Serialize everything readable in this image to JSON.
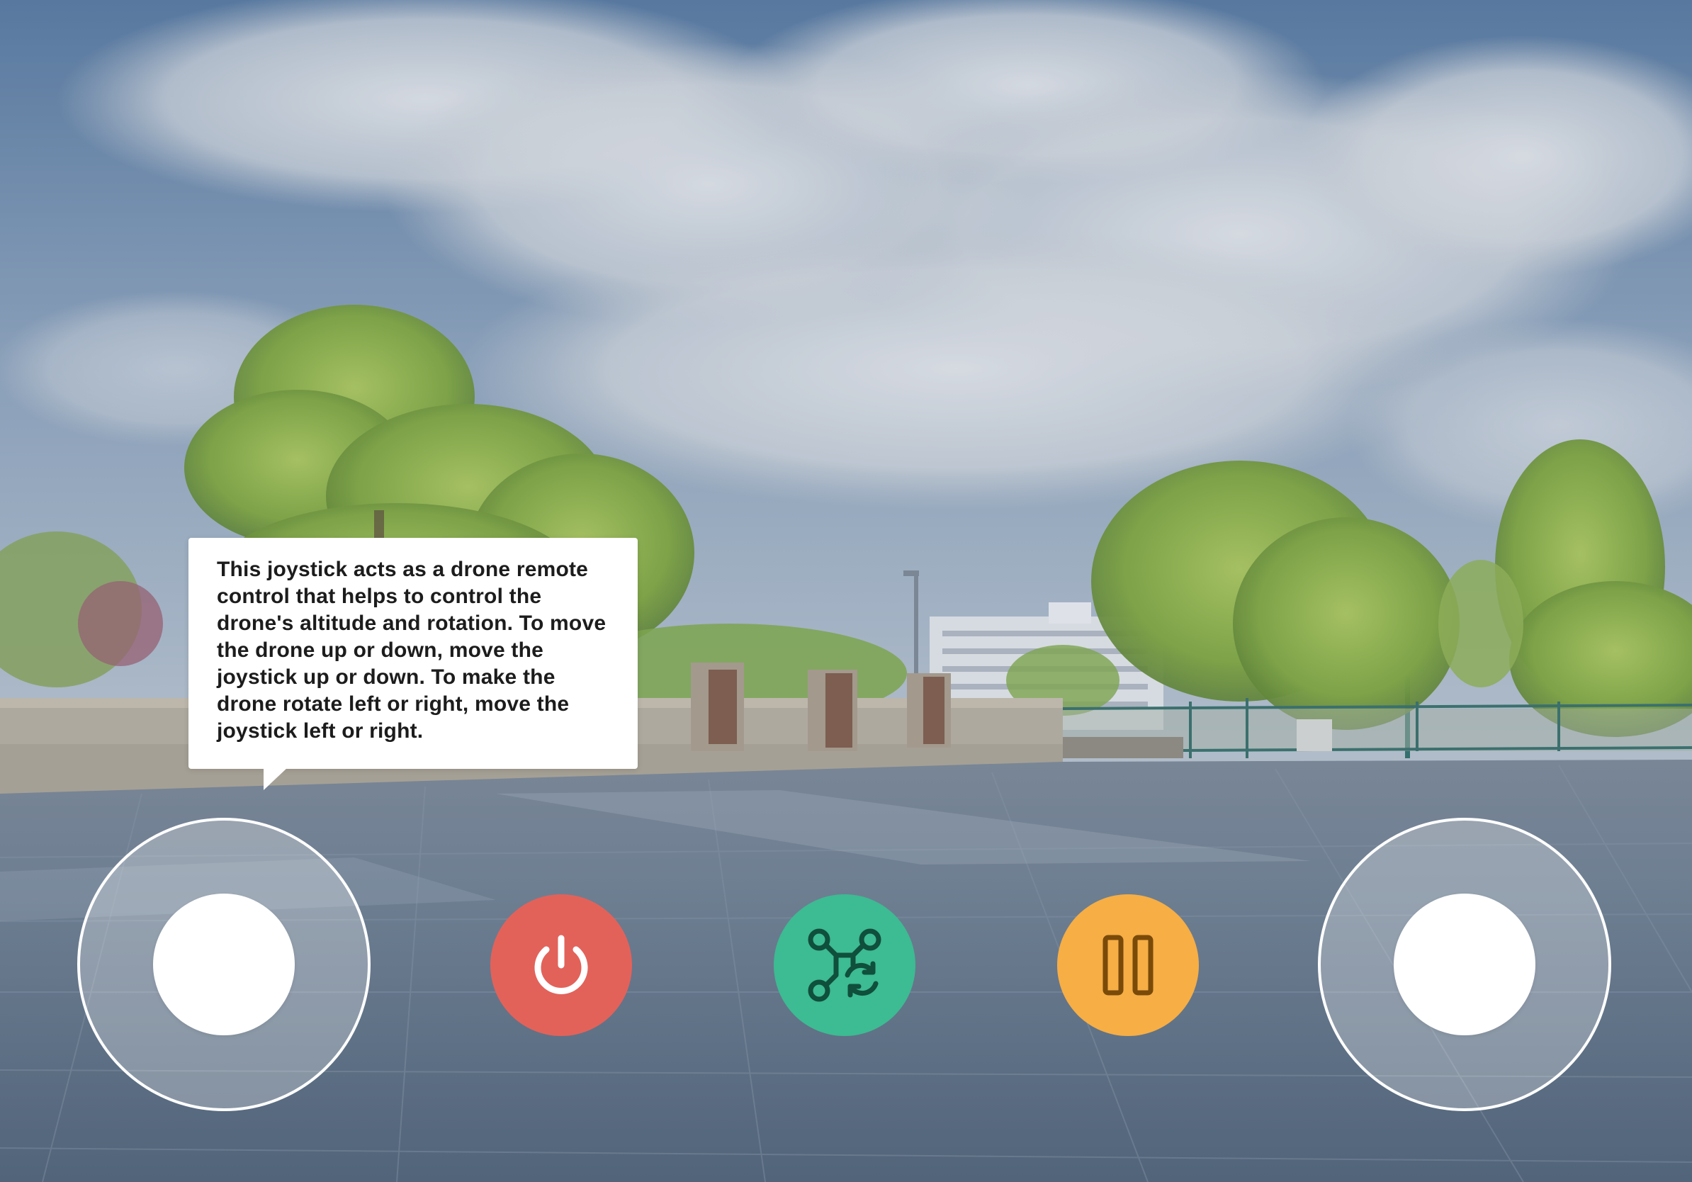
{
  "tooltip": {
    "text": "This joystick acts as a drone remote control that helps to control the drone's altitude and rotation. To move the drone up or down, move the joystick up or down. To make the drone rotate left or right, move the joystick left or right."
  },
  "controls": {
    "power_button": {
      "icon": "power-icon",
      "color": "#e2625a"
    },
    "drone_button": {
      "icon": "drone-rotate-icon",
      "color": "#3dbb92",
      "icon_color": "#0f4f3c"
    },
    "pause_button": {
      "icon": "pause-icon",
      "color": "#f6ae45",
      "icon_color": "#7a4a09"
    }
  },
  "joysticks": {
    "left": {
      "role": "altitude-rotation"
    },
    "right": {
      "role": "movement"
    }
  }
}
